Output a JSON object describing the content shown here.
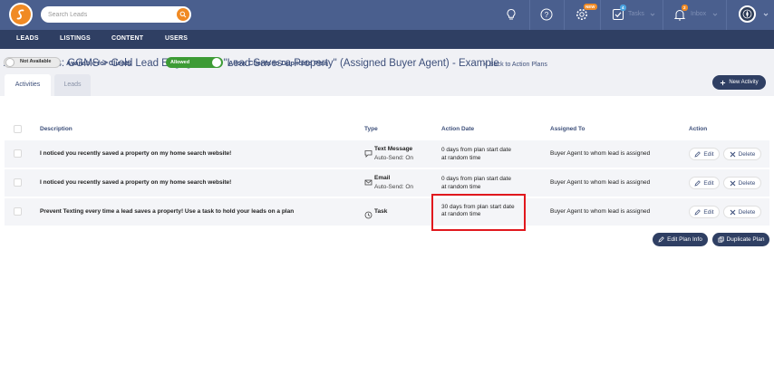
{
  "header": {
    "search_placeholder": "Search Leads",
    "tasks_label": "Tasks",
    "inbox_label": "Inbox",
    "settings_badge": "NEW",
    "tasks_badge": "4",
    "inbox_badge": "2",
    "icons": [
      "search-icon",
      "lightbulb-icon",
      "help-icon",
      "gear-icon",
      "checkbox-icon",
      "bell-icon"
    ]
  },
  "nav": {
    "items": [
      {
        "label": "LEADS"
      },
      {
        "label": "LISTINGS"
      },
      {
        "label": "CONTENT"
      },
      {
        "label": "USERS"
      }
    ]
  },
  "page": {
    "title": "Action Plans: GGMS > Cold Lead Engagement \"Lead Saves a Property\" (Assigned Buyer Agent) - Example",
    "back_link": "< Back to Action Plans",
    "new_activity_label": "New Activity"
  },
  "tabs": [
    {
      "label": "Activities",
      "active": true
    },
    {
      "label": "Leads",
      "active": false
    }
  ],
  "toggles": {
    "clients_toggle_label": "Not Available",
    "clients_caption": "Available for Clients",
    "duplicate_toggle_label": "Allowed",
    "duplicate_caption": "Allow Clients to Duplicate Plan"
  },
  "table": {
    "headers": {
      "description": "Description",
      "type": "Type",
      "action_date": "Action Date",
      "assigned_to": "Assigned To",
      "action": "Action"
    },
    "rows": [
      {
        "description": "I noticed you recently saved a property on my home search website!",
        "type": "Text Message",
        "type_sub": "Auto-Send: On",
        "type_icon": "chat-icon",
        "date_line1": "0 days from plan start date",
        "date_line2": "at random time",
        "assigned": "Buyer Agent to whom lead is assigned"
      },
      {
        "description": "I noticed you recently saved a property on my home search website!",
        "type": "Email",
        "type_sub": "Auto-Send: On",
        "type_icon": "envelope-icon",
        "date_line1": "0 days from plan start date",
        "date_line2": "at random time",
        "assigned": "Buyer Agent to whom lead is assigned"
      },
      {
        "description": "Prevent Texting every time a lead saves a property! Use a task to hold your leads on a plan",
        "type": "Task",
        "type_sub": "",
        "type_icon": "clock-icon",
        "date_line1": "30 days from plan start date",
        "date_line2": "at random time",
        "assigned": "Buyer Agent to whom lead is assigned"
      }
    ],
    "edit_label": "Edit",
    "delete_label": "Delete"
  },
  "footer_actions": {
    "edit_plan_info": "Edit Plan Info",
    "duplicate_plan": "Duplicate Plan"
  },
  "colors": {
    "topbar": "#4a5f8e",
    "navbar": "#2f3f63",
    "accent": "#f08a24",
    "toggle_on": "#3d9b35",
    "highlight": "#e1181d"
  }
}
